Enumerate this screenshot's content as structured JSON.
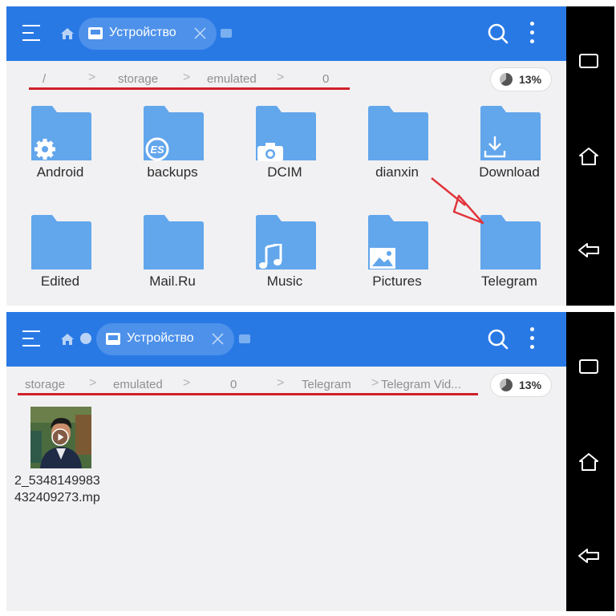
{
  "colors": {
    "appbar": "#2979e5",
    "redline": "#d0202b",
    "folder": "#62a6ec",
    "navbar": "#000000"
  },
  "top": {
    "toolbar": {
      "tab_label": "Устройство",
      "icons": [
        "menu-icon",
        "home-icon",
        "drive-icon",
        "close-icon",
        "search-icon",
        "more-vert-icon"
      ]
    },
    "breadcrumb": [
      "/",
      "storage",
      "emulated",
      "0"
    ],
    "storage_percent": "13%",
    "folders": [
      {
        "name": "Android",
        "icon": "gear-icon"
      },
      {
        "name": "backups",
        "icon": "es-logo-icon"
      },
      {
        "name": "DCIM",
        "icon": "camera-icon"
      },
      {
        "name": "dianxin",
        "icon": ""
      },
      {
        "name": "Download",
        "icon": "download-icon"
      },
      {
        "name": "Edited",
        "icon": ""
      },
      {
        "name": "Mail.Ru",
        "icon": ""
      },
      {
        "name": "Music",
        "icon": "music-note-icon"
      },
      {
        "name": "Pictures",
        "icon": "image-icon"
      },
      {
        "name": "Telegram",
        "icon": ""
      }
    ]
  },
  "bottom": {
    "toolbar": {
      "tab_label": "Устройство",
      "icons": [
        "menu-icon",
        "home-icon",
        "history-icon",
        "drive-icon",
        "close-icon",
        "search-icon",
        "more-vert-icon"
      ]
    },
    "breadcrumb": [
      "storage",
      "emulated",
      "0",
      "Telegram",
      "Telegram Vid..."
    ],
    "storage_percent": "13%",
    "file": {
      "name_line1": "2_5348149983",
      "name_line2": "432409273.mp"
    }
  },
  "navbar": {
    "buttons": [
      "recent-apps-icon",
      "home-icon",
      "back-icon"
    ]
  }
}
